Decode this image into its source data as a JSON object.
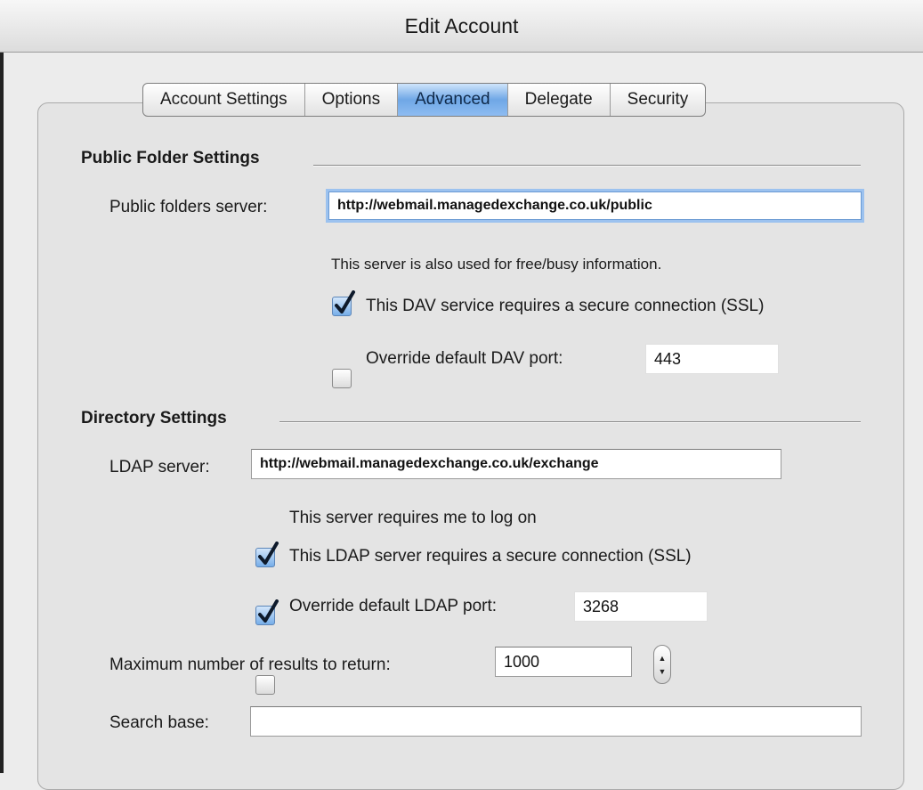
{
  "window": {
    "title": "Edit Account"
  },
  "tabs": [
    {
      "label": "Account Settings"
    },
    {
      "label": "Options"
    },
    {
      "label": "Advanced"
    },
    {
      "label": "Delegate"
    },
    {
      "label": "Security"
    }
  ],
  "active_tab": "Advanced",
  "public_folder": {
    "section_title": "Public Folder Settings",
    "server_label": "Public folders server:",
    "server_value": "http://webmail.managedexchange.co.uk/public",
    "info_text": "This server is also used for free/busy information.",
    "ssl_label": "This DAV service requires a secure connection (SSL)",
    "ssl_checked": true,
    "override_port_label": "Override default DAV port:",
    "override_port_checked": false,
    "port_value": "443"
  },
  "directory": {
    "section_title": "Directory Settings",
    "ldap_label": "LDAP server:",
    "ldap_value": "http://webmail.managedexchange.co.uk/exchange",
    "logon_label": "This server requires me to log on",
    "logon_checked": true,
    "ssl_label": "This LDAP server requires a secure connection (SSL)",
    "ssl_checked": true,
    "override_port_label": "Override default LDAP port:",
    "override_port_checked": false,
    "port_value": "3268",
    "max_results_label": "Maximum number of results to return:",
    "max_results_value": "1000",
    "search_base_label": "Search base:",
    "search_base_value": ""
  },
  "colors": {
    "accent": "#6fa7e6",
    "check_mark": "#0e1a2b",
    "focus_ring": "#9cc2ef"
  },
  "icons": {
    "check": "check-mark-icon",
    "stepper_up": "triangle-up-icon",
    "stepper_down": "triangle-down-icon"
  }
}
